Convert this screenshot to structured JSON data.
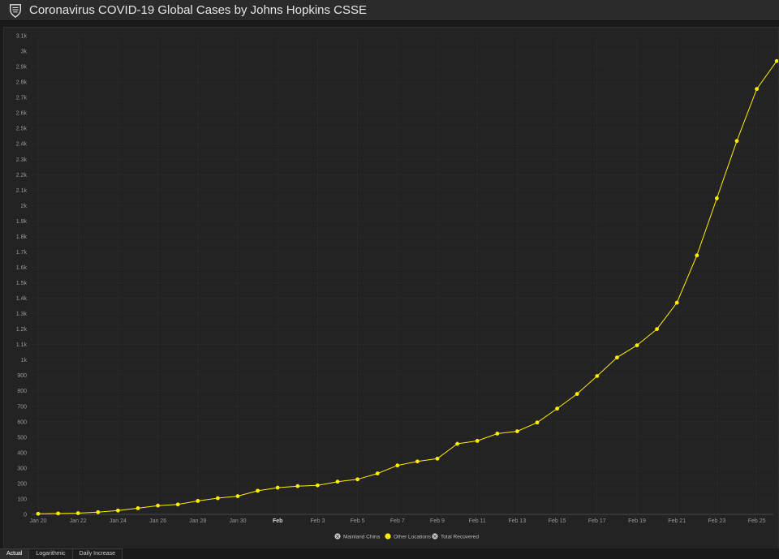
{
  "app": {
    "title": "Coronavirus COVID-19 Global Cases by Johns Hopkins CSSE"
  },
  "tabs": [
    {
      "label": "Actual",
      "active": true
    },
    {
      "label": "Logarithmic",
      "active": false
    },
    {
      "label": "Daily Increase",
      "active": false
    }
  ],
  "colors": {
    "series_other": "#ffee00",
    "legend_disabled": "#cfcfcf",
    "grid": "#333333",
    "axis_text": "#9a9a9a"
  },
  "chart_data": {
    "type": "line",
    "x": [
      "Jan 20",
      "Jan 21",
      "Jan 22",
      "Jan 23",
      "Jan 24",
      "Jan 25",
      "Jan 26",
      "Jan 27",
      "Jan 28",
      "Jan 29",
      "Jan 30",
      "Jan 31",
      "Feb 1",
      "Feb 2",
      "Feb 3",
      "Feb 4",
      "Feb 5",
      "Feb 6",
      "Feb 7",
      "Feb 8",
      "Feb 9",
      "Feb 10",
      "Feb 11",
      "Feb 12",
      "Feb 13",
      "Feb 14",
      "Feb 15",
      "Feb 16",
      "Feb 17",
      "Feb 18",
      "Feb 19",
      "Feb 20",
      "Feb 21",
      "Feb 22",
      "Feb 23",
      "Feb 24",
      "Feb 25",
      "Feb 26"
    ],
    "x_tick_labels": [
      "Jan 20",
      "Jan 22",
      "Jan 24",
      "Jan 26",
      "Jan 28",
      "Jan 30",
      "Feb",
      "Feb 3",
      "Feb 5",
      "Feb 7",
      "Feb 9",
      "Feb 11",
      "Feb 13",
      "Feb 15",
      "Feb 17",
      "Feb 19",
      "Feb 21",
      "Feb 23",
      "Feb 25"
    ],
    "y_tick_labels": [
      "0",
      "100",
      "200",
      "300",
      "400",
      "500",
      "600",
      "700",
      "800",
      "900",
      "1k",
      "1.1k",
      "1.2k",
      "1.3k",
      "1.4k",
      "1.5k",
      "1.6k",
      "1.7k",
      "1.8k",
      "1.9k",
      "2k",
      "2.1k",
      "2.2k",
      "2.3k",
      "2.4k",
      "2.5k",
      "2.6k",
      "2.7k",
      "2.8k",
      "2.9k",
      "3k",
      "3.1k"
    ],
    "ylim": [
      0,
      3100
    ],
    "series": [
      {
        "name": "Other Locations",
        "values": [
          4,
          6,
          8,
          14,
          25,
          40,
          57,
          64,
          87,
          105,
          118,
          153,
          173,
          183,
          188,
          212,
          227,
          265,
          317,
          343,
          361,
          457,
          476,
          523,
          538,
          595,
          685,
          780,
          896,
          1016,
          1095,
          1200,
          1371,
          1677,
          2047,
          2418,
          2755,
          2936
        ]
      }
    ],
    "legend": [
      {
        "name": "Mainland China",
        "enabled": false
      },
      {
        "name": "Other Locations",
        "enabled": true
      },
      {
        "name": "Total Recovered",
        "enabled": false
      }
    ],
    "legend_position": "bottom-center",
    "grid": true
  }
}
